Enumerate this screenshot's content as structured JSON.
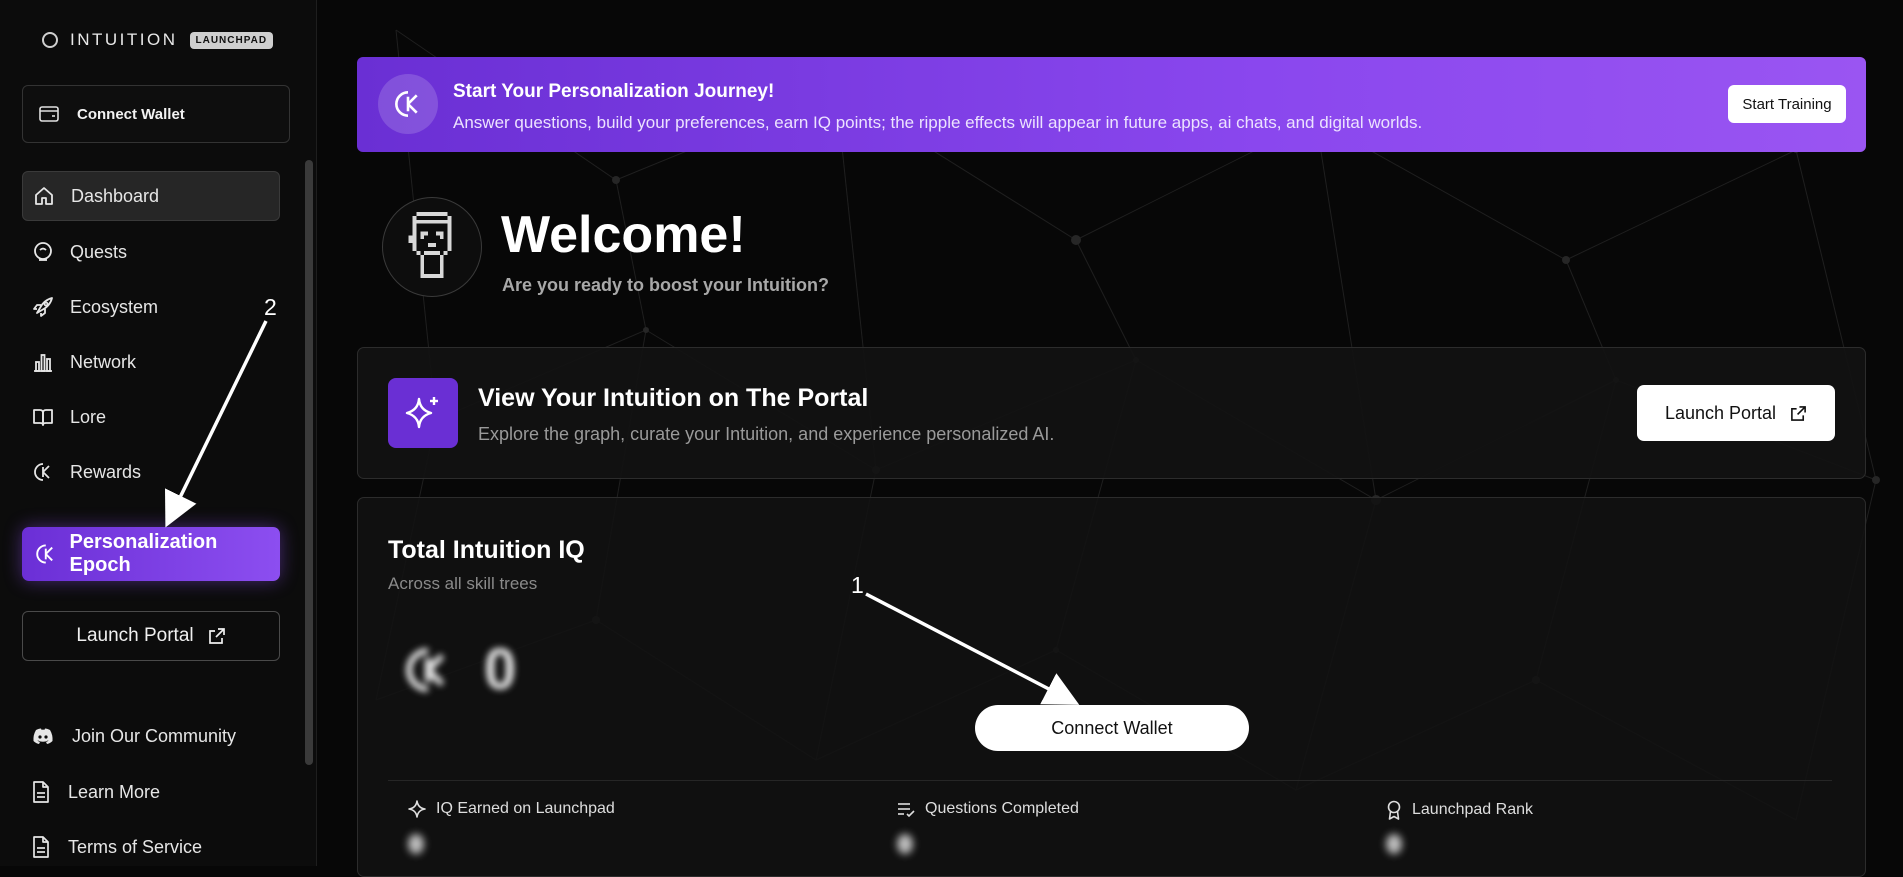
{
  "brand": {
    "name": "INTUITION",
    "badge": "LAUNCHPAD"
  },
  "sidebar": {
    "connect_wallet": "Connect Wallet",
    "nav": [
      {
        "label": "Dashboard",
        "icon": "home-icon",
        "active": true
      },
      {
        "label": "Quests",
        "icon": "quests-icon"
      },
      {
        "label": "Ecosystem",
        "icon": "rocket-icon"
      },
      {
        "label": "Network",
        "icon": "bar-chart-icon"
      },
      {
        "label": "Lore",
        "icon": "book-icon"
      },
      {
        "label": "Rewards",
        "icon": "iq-coin-icon"
      }
    ],
    "epoch_label": "Personalization Epoch",
    "launch_portal": "Launch Portal",
    "footer": [
      {
        "label": "Join Our Community",
        "icon": "discord-icon"
      },
      {
        "label": "Learn More",
        "icon": "document-icon"
      },
      {
        "label": "Terms of Service",
        "icon": "document-icon"
      }
    ]
  },
  "banner": {
    "title": "Start Your Personalization Journey!",
    "subtitle": "Answer questions, build your preferences, earn IQ points; the ripple effects will appear in future apps, ai chats, and digital worlds.",
    "button": "Start Training"
  },
  "welcome": {
    "title": "Welcome!",
    "subtitle": "Are you ready to boost your Intuition?"
  },
  "portal_card": {
    "title": "View Your Intuition on The Portal",
    "subtitle": "Explore the graph, curate your Intuition, and experience personalized AI.",
    "button": "Launch Portal"
  },
  "iq_card": {
    "title": "Total Intuition IQ",
    "subtitle": "Across all skill trees",
    "value": "0",
    "connect_button": "Connect Wallet",
    "stats": [
      {
        "label": "IQ Earned on Launchpad",
        "icon": "sparkle-icon"
      },
      {
        "label": "Questions Completed",
        "icon": "checklist-icon"
      },
      {
        "label": "Launchpad Rank",
        "icon": "award-icon"
      }
    ]
  },
  "annotations": {
    "marker_1": "1",
    "marker_2": "2"
  },
  "colors": {
    "accent": "#7c3aed",
    "background": "#070707",
    "sidebar": "#0c0c0c"
  }
}
